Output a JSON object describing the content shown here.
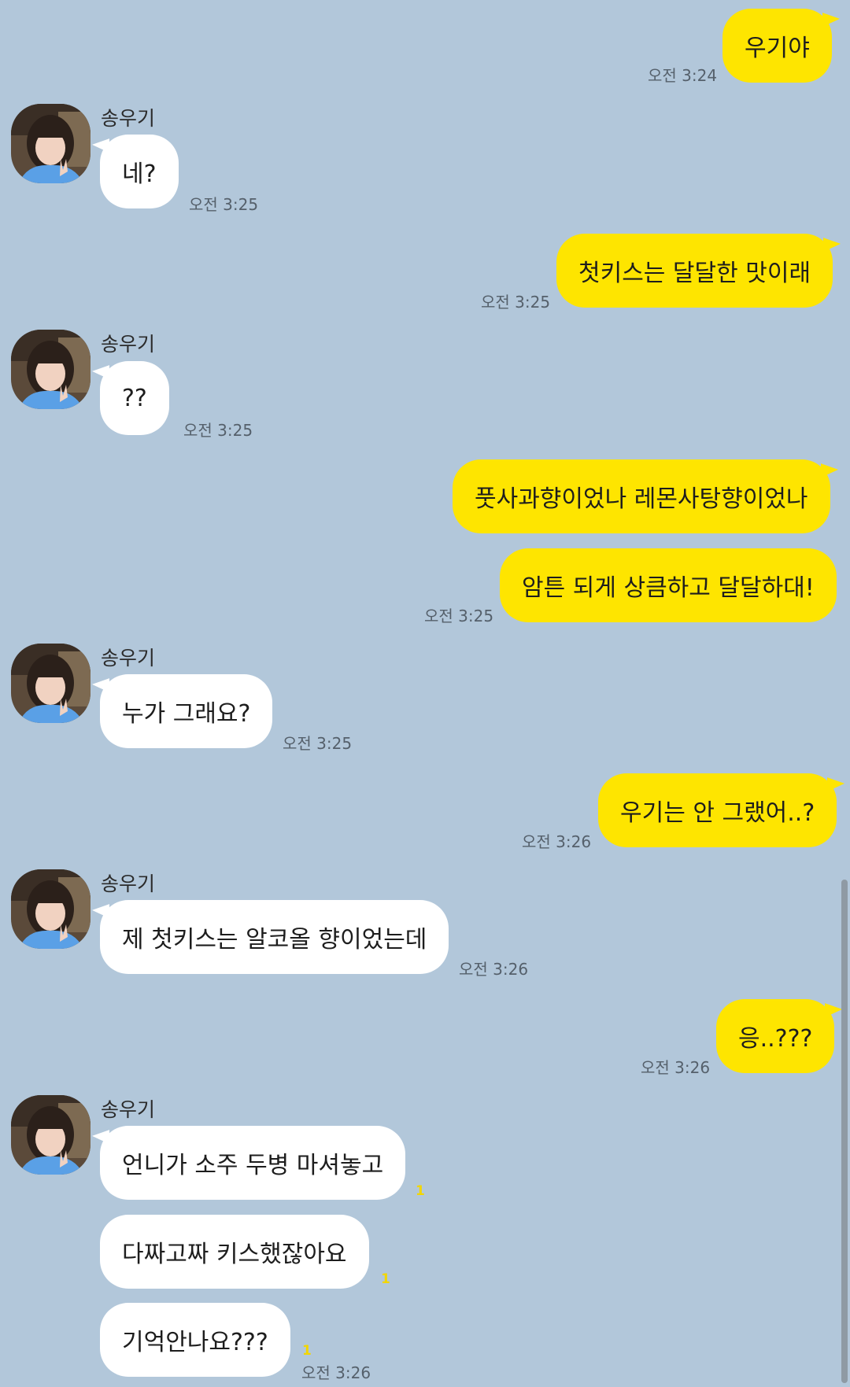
{
  "contact": {
    "name": "송우기"
  },
  "messages": [
    {
      "from": "me",
      "text": "우기야",
      "time": "오전 3:24"
    },
    {
      "from": "them",
      "text": "네?",
      "time": "오전 3:25"
    },
    {
      "from": "me",
      "text": "첫키스는 달달한 맛이래",
      "time": "오전 3:25"
    },
    {
      "from": "them",
      "text": "??",
      "time": "오전 3:25"
    },
    {
      "from": "me",
      "text": "풋사과향이었나 레몬사탕향이었나"
    },
    {
      "from": "me",
      "text": "암튼 되게 상큼하고 달달하대!",
      "time": "오전 3:25"
    },
    {
      "from": "them",
      "text": "누가 그래요?",
      "time": "오전 3:25"
    },
    {
      "from": "me",
      "text": "우기는 안 그랬어..?",
      "time": "오전 3:26"
    },
    {
      "from": "them",
      "text": "제 첫키스는 알코올 향이었는데",
      "time": "오전 3:26"
    },
    {
      "from": "me",
      "text": "응..???",
      "time": "오전 3:26"
    },
    {
      "from": "them",
      "text": "언니가 소주 두병 마셔놓고",
      "unread": "1"
    },
    {
      "from": "them",
      "text": "다짜고짜 키스했잖아요",
      "unread": "1"
    },
    {
      "from": "them",
      "text": "기억안나요???",
      "unread": "1",
      "time": "오전 3:26"
    }
  ],
  "colors": {
    "background": "#b2c7da",
    "my_bubble": "#fee500",
    "their_bubble": "#ffffff",
    "unread": "#f2d600"
  }
}
